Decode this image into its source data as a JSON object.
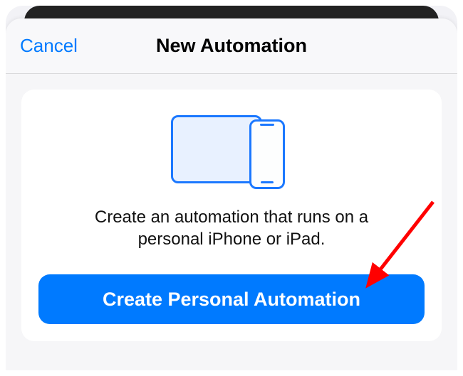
{
  "nav": {
    "cancel_label": "Cancel",
    "title": "New Automation"
  },
  "card": {
    "description": "Create an automation that runs on a personal iPhone or iPad.",
    "primary_button_label": "Create Personal Automation"
  },
  "colors": {
    "accent": "#007aff",
    "arrow": "#ff0000"
  }
}
